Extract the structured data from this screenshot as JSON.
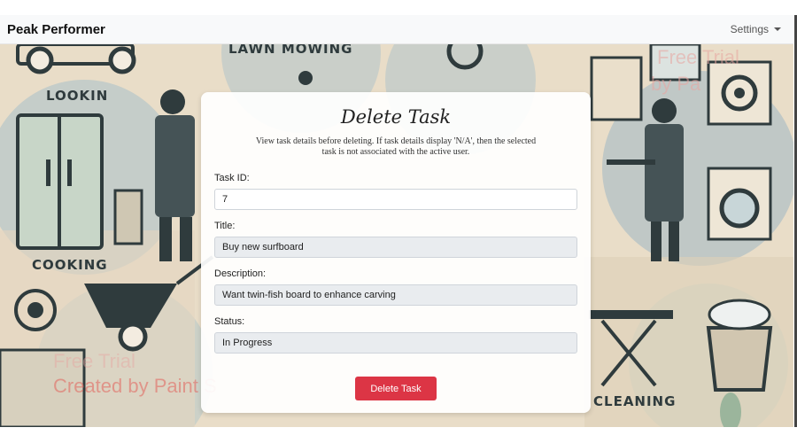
{
  "navbar": {
    "brand": "Peak Performer",
    "settings_label": "Settings"
  },
  "background": {
    "labels": {
      "lawn_mowing": "LAWN MOWING",
      "looking": "LOOKIN",
      "cooking": "COOKING",
      "cleaning": "CLEANING"
    },
    "watermark": {
      "line1": "Free Trial",
      "line2": "by Pa",
      "bottom1": "Free Trial",
      "bottom2": "Created by Paint S"
    }
  },
  "form": {
    "title": "Delete Task",
    "description": "View task details before deleting. If task details display 'N/A', then the selected task is not associated with the active user.",
    "task_id_label": "Task ID:",
    "task_id_value": "7",
    "title_label": "Title:",
    "title_value": "Buy new surfboard",
    "description_label": "Description:",
    "description_value": "Want twin-fish board to enhance carving",
    "status_label": "Status:",
    "status_value": "In Progress",
    "delete_button": "Delete Task"
  },
  "colors": {
    "danger": "#dc3545",
    "navbar_bg": "#f8f9fa",
    "readonly_bg": "#e9ecef"
  }
}
